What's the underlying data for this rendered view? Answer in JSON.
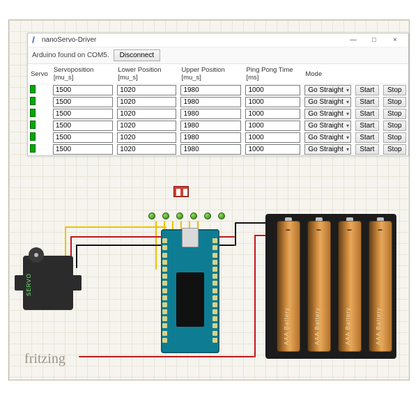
{
  "window": {
    "title": "nanoServo-Driver",
    "minimize_symbol": "—",
    "maximize_symbol": "□",
    "close_symbol": "×"
  },
  "statusbar": {
    "message": "Arduino found on COM5.",
    "disconnect_label": "Disconnect"
  },
  "columns": {
    "servo": "Servo",
    "servoposition": "Servoposition [mu_s]",
    "lower": "Lower Position [mu_s]",
    "upper": "Upper Position [mu_s]",
    "ping": "Ping Pong Time [ms]",
    "mode": "Mode"
  },
  "row_buttons": {
    "start": "Start",
    "stop": "Stop"
  },
  "rows": [
    {
      "pos": "1500",
      "low": "1020",
      "up": "1980",
      "ping": "1000",
      "mode": "Go Straight"
    },
    {
      "pos": "1500",
      "low": "1020",
      "up": "1980",
      "ping": "1000",
      "mode": "Go Straight"
    },
    {
      "pos": "1500",
      "low": "1020",
      "up": "1980",
      "ping": "1000",
      "mode": "Go Straight"
    },
    {
      "pos": "1500",
      "low": "1020",
      "up": "1980",
      "ping": "1000",
      "mode": "Go Straight"
    },
    {
      "pos": "1500",
      "low": "1020",
      "up": "1980",
      "ping": "1000",
      "mode": "Go Straight"
    },
    {
      "pos": "1500",
      "low": "1020",
      "up": "1980",
      "ping": "1000",
      "mode": "Go Straight"
    }
  ],
  "components": {
    "servo_label": "SERVO",
    "battery_label": "AAA Battery",
    "battery_minus": "−"
  },
  "brand": "fritzing"
}
